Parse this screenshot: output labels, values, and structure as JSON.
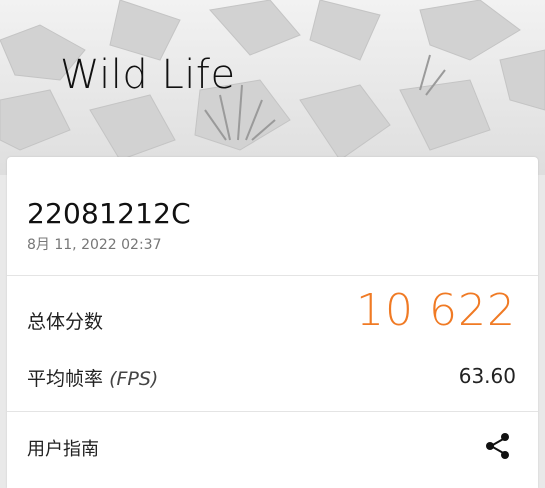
{
  "header": {
    "title": "Wild Life",
    "background_icon": "rocky-landscape"
  },
  "result": {
    "device_name": "22081212C",
    "date": "8月 11, 2022 02:37",
    "score_label": "总体分数",
    "score_value": "10 622",
    "fps_label": "平均帧率",
    "fps_unit": "(FPS)",
    "fps_value": "63.60",
    "guide_label": "用户指南",
    "share_icon": "share-icon"
  },
  "colors": {
    "accent": "#f07a24",
    "background": "#e9e9e9",
    "card": "#ffffff",
    "text": "#222222",
    "muted": "#777777"
  }
}
